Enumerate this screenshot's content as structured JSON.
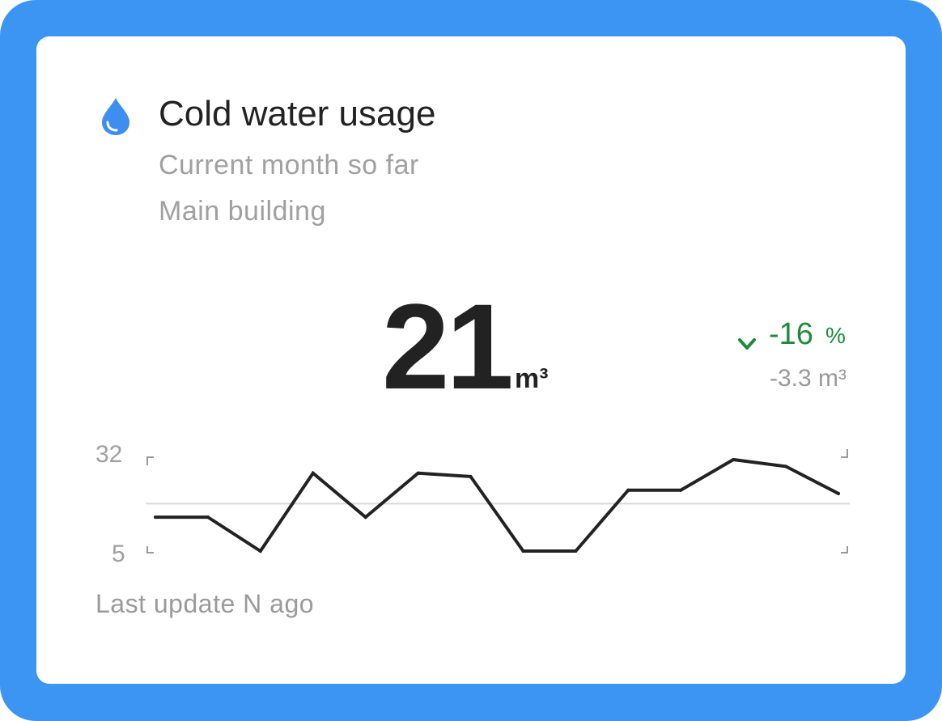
{
  "card": {
    "icon": "water-drop-icon",
    "title": "Cold water usage",
    "subtitle_1": "Current month so far",
    "subtitle_2": "Main building",
    "value": "21",
    "unit": "m³",
    "delta": {
      "direction": "down",
      "icon": "arrow-down-icon",
      "percent": "-16",
      "percent_unit": "%",
      "absolute": "-3.3 m³"
    },
    "footer": "Last update N ago"
  },
  "colors": {
    "frame": "#3d95f3",
    "accent": "#3d8ef0",
    "positive": "#1f8a3d",
    "text": "#222222",
    "muted": "#a0a0a0",
    "line": "#222222",
    "average_line": "#d9d9d9"
  },
  "chart_data": {
    "type": "line",
    "y_tick_labels": [
      "32",
      "5"
    ],
    "ylim": [
      5,
      32
    ],
    "series": [
      {
        "values": [
          15,
          15,
          5,
          28,
          15,
          28,
          27,
          5,
          5,
          23,
          23,
          32,
          30,
          22
        ]
      }
    ],
    "average": 19
  }
}
